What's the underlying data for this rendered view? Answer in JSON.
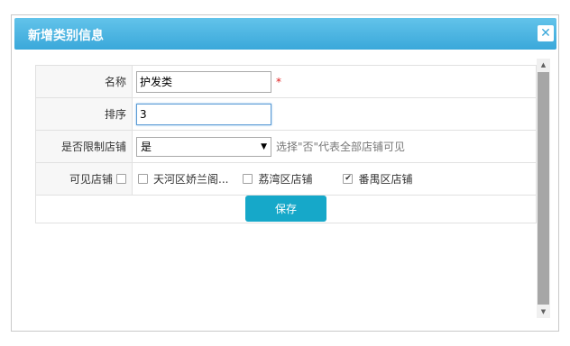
{
  "dialog": {
    "title": "新增类别信息",
    "close_icon": "close-icon"
  },
  "form": {
    "name_label": "名称",
    "name_value": "护发类",
    "required_mark": "*",
    "sort_label": "排序",
    "sort_value": "3",
    "restrict_label": "是否限制店铺",
    "restrict_value": "是",
    "restrict_hint": "选择\"否\"代表全部店铺可见",
    "visible_label": "可见店铺",
    "stores": [
      {
        "label": "天河区娇兰阁...",
        "checked": false
      },
      {
        "label": "荔湾区店铺",
        "checked": false
      },
      {
        "label": "番禺区店铺",
        "checked": true
      }
    ],
    "save_label": "保存"
  },
  "colors": {
    "titlebar": "#3aa8da",
    "save_button": "#16a8c9",
    "required": "#e02020"
  }
}
